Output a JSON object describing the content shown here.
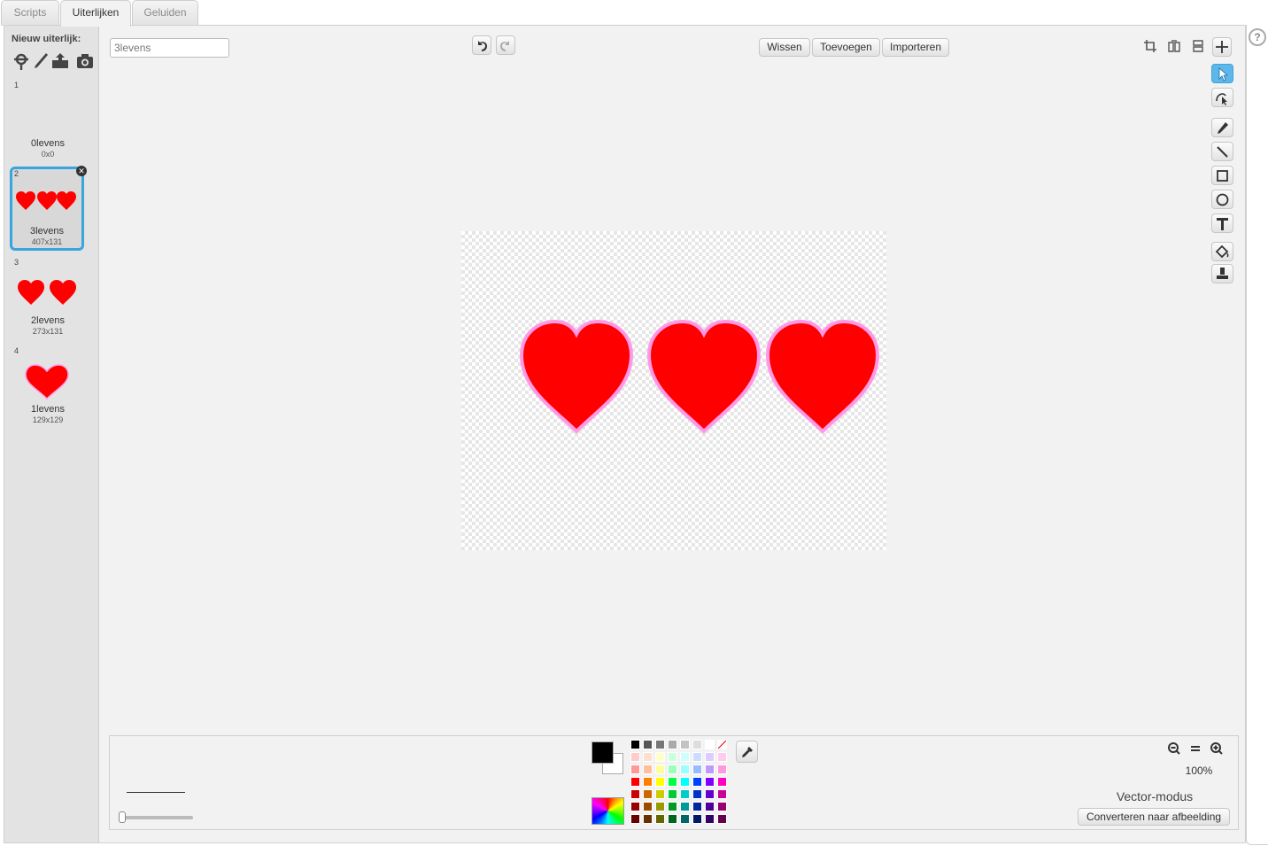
{
  "tabs": [
    "Scripts",
    "Uiterlijken",
    "Geluiden"
  ],
  "active_tab": "Uiterlijken",
  "costume_pane": {
    "new_costume_label": "Nieuw uiterlijk:",
    "new_costume_icons": [
      "choose-from-library-icon",
      "paint-new-icon",
      "upload-from-file-icon",
      "camera-icon"
    ],
    "costumes": [
      {
        "num": "1",
        "name": "0levens",
        "size": "0x0",
        "hearts": 0
      },
      {
        "num": "2",
        "name": "3levens",
        "size": "407x131",
        "hearts": 3,
        "selected": true
      },
      {
        "num": "3",
        "name": "2levens",
        "size": "273x131",
        "hearts": 2
      },
      {
        "num": "4",
        "name": "1levens",
        "size": "129x129",
        "hearts": 1
      }
    ],
    "delete_glyph": "✕"
  },
  "editor": {
    "costume_name": "3levens",
    "undo_icon": "undo-icon",
    "redo_icon": "redo-icon",
    "buttons": {
      "clear": "Wissen",
      "add": "Toevoegen",
      "import": "Importeren"
    },
    "top_right_icons": [
      "crop-icon",
      "flip-horizontal-icon",
      "flip-vertical-icon",
      "set-center-icon"
    ],
    "tools": [
      "select-icon",
      "reshape-icon",
      "pencil-icon",
      "line-icon",
      "rectangle-icon",
      "ellipse-icon",
      "text-icon",
      "fill-icon",
      "duplicate-stamp-icon"
    ],
    "active_tool": "select-icon"
  },
  "bottom": {
    "zoom_level": "100%",
    "mode_label": "Vector-modus",
    "convert_button": "Converteren naar afbeelding",
    "foreground_color": "#000000",
    "background_color": "#ffffff",
    "palette_rows": [
      [
        "#000000",
        "#555555",
        "#777777",
        "#aaaaaa",
        "#c3c3c3",
        "#dddddd",
        "#ffffff",
        "none"
      ],
      [
        "#ffcccc",
        "#ffe0cc",
        "#ffffcc",
        "#ccffdd",
        "#ccffff",
        "#ccddff",
        "#ddccff",
        "#ffccee"
      ],
      [
        "#ff9999",
        "#ffc099",
        "#ffff99",
        "#99ffbb",
        "#99ffff",
        "#99bbff",
        "#bb99ff",
        "#ff99dd"
      ],
      [
        "#ff0000",
        "#ff8000",
        "#ffff00",
        "#00ff40",
        "#00ffff",
        "#0040ff",
        "#8000ff",
        "#ff00c0"
      ],
      [
        "#cc0000",
        "#cc6600",
        "#cccc00",
        "#00cc33",
        "#00cccc",
        "#0033cc",
        "#6600cc",
        "#cc0099"
      ],
      [
        "#990000",
        "#994c00",
        "#999900",
        "#009926",
        "#009999",
        "#002699",
        "#4c0099",
        "#990073"
      ],
      [
        "#660000",
        "#663300",
        "#666600",
        "#00661a",
        "#006666",
        "#001a66",
        "#330066",
        "#66004d"
      ]
    ],
    "heart_color": "#ff0000",
    "heart_outline": "#ff99e6"
  }
}
